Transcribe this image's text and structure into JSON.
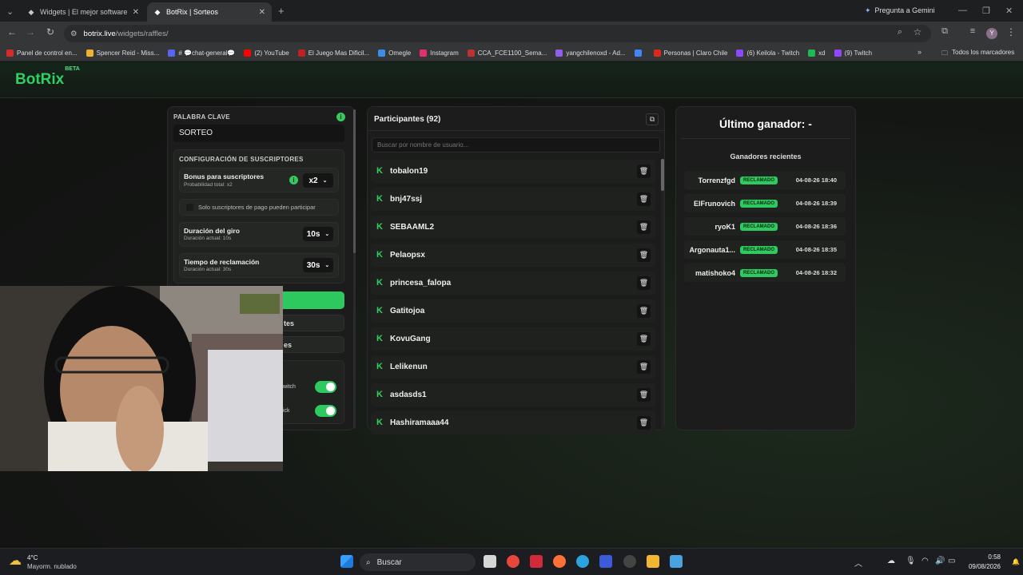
{
  "browser": {
    "tabs": [
      {
        "title": "Widgets | El mejor software pa",
        "active": false
      },
      {
        "title": "BotRix | Sorteos",
        "active": true
      }
    ],
    "gemini_label": "Pregunta a Gemini",
    "url_domain": "botrix.live",
    "url_path": "/widgets/raffles/",
    "profile_initial": "Y",
    "bookmarks": [
      {
        "label": "Panel de control en...",
        "color": "#d42a2a"
      },
      {
        "label": "Spencer Reid - Miss...",
        "color": "#f0b030"
      },
      {
        "label": "# 💬chat-general💬",
        "color": "#5865f2"
      },
      {
        "label": "(2) YouTube",
        "color": "#ff0000"
      },
      {
        "label": "El Juego Mas Dificil...",
        "color": "#c02020"
      },
      {
        "label": "Omegle",
        "color": "#3a8ee6"
      },
      {
        "label": "Instagram",
        "color": "#e1306c"
      },
      {
        "label": "CCA_FCE1100_Sema...",
        "color": "#c03030"
      },
      {
        "label": "yangchilenoxd - Ad...",
        "color": "#8f5fe8"
      },
      {
        "label": "",
        "color": "#4285f4"
      },
      {
        "label": "Personas | Claro Chile",
        "color": "#da291c"
      },
      {
        "label": "(6) Keilola - Twitch",
        "color": "#9146ff"
      },
      {
        "label": "xd",
        "color": "#1db954"
      },
      {
        "label": "(9) Twitch",
        "color": "#9146ff"
      }
    ],
    "all_bookmarks_label": "Todos los marcadores"
  },
  "site": {
    "logo": "BotRix",
    "logo_badge": "BETA"
  },
  "config": {
    "keyword_label": "PALABRA CLAVE",
    "keyword_value": "SORTEO",
    "subs_title": "CONFIGURACIÓN DE SUSCRIPTORES",
    "bonus_label": "Bonus para suscriptores",
    "bonus_sub": "Probabilidad total: x2",
    "bonus_value": "x2",
    "paid_only_label": "Solo suscriptores de pago pueden participar",
    "spin_label": "Duración del giro",
    "spin_sub": "Duración actual: 10s",
    "spin_value": "10s",
    "claim_label": "Tiempo de reclamación",
    "claim_sub": "Duración actual: 30s",
    "claim_value": "30s",
    "partial_btn1": "tes",
    "partial_btn2": "es",
    "partial_toggle1": "witch",
    "partial_toggle2": "ick"
  },
  "participants": {
    "title": "Participantes (92)",
    "search_placeholder": "Buscar por nombre de usuario...",
    "items": [
      "tobalon19",
      "bnj47ssj",
      "SEBAAML2",
      "Pelaopsx",
      "princesa_falopa",
      "Gatitojoa",
      "KovuGang",
      "Lelikenun",
      "asdasds1",
      "Hashiramaaa44"
    ]
  },
  "winners": {
    "last_winner": "Último ganador: -",
    "recent_title": "Ganadores recientes",
    "items": [
      {
        "name": "Torrenzfgd",
        "status": "RECLAMADO",
        "date": "04-08-26 18:40"
      },
      {
        "name": "ElFrunovich",
        "status": "RECLAMADO",
        "date": "04-08-26 18:39"
      },
      {
        "name": "ryoK1",
        "status": "RECLAMADO",
        "date": "04-08-26 18:36"
      },
      {
        "name": "Argonauta1...",
        "status": "RECLAMADO",
        "date": "04-08-26 18:35"
      },
      {
        "name": "matishoko4",
        "status": "RECLAMADO",
        "date": "04-08-26 18:32"
      }
    ]
  },
  "taskbar": {
    "temp": "4°C",
    "weather": "Mayorm. nublado",
    "search": "Buscar",
    "time": "0:58",
    "date": "09/08/2026"
  }
}
